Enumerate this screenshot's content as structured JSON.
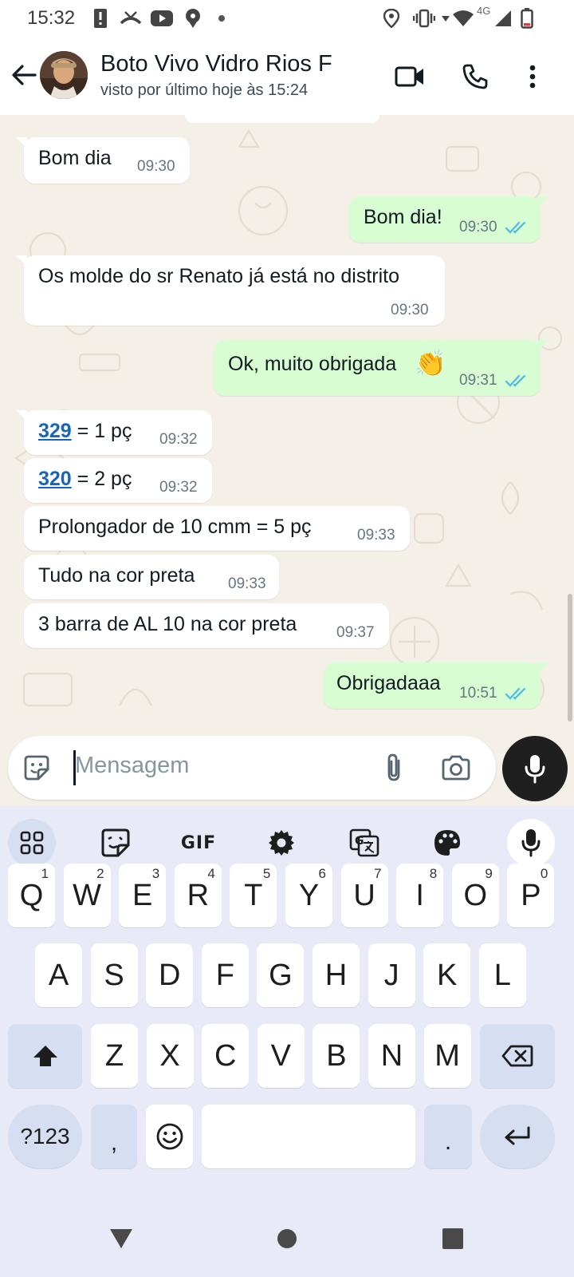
{
  "status_bar": {
    "time": "15:32",
    "network": "4G"
  },
  "header": {
    "contact_name": "Boto Vivo Vidro Rios F",
    "last_seen": "visto por último hoje às 15:24"
  },
  "messages": [
    {
      "dir": "in",
      "text": "Bom dia",
      "time": "09:30"
    },
    {
      "dir": "out",
      "text": "Bom dia!",
      "time": "09:30",
      "read": true
    },
    {
      "dir": "in",
      "text": "Os molde do sr Renato já está no distrito",
      "time": "09:30"
    },
    {
      "dir": "out",
      "text": "Ok, muito obrigada",
      "emoji": "👏",
      "time": "09:31",
      "read": true
    },
    {
      "dir": "in",
      "link": "329",
      "text": " = 1 pç",
      "time": "09:32"
    },
    {
      "dir": "in",
      "link": "320",
      "text": " = 2 pç",
      "time": "09:32"
    },
    {
      "dir": "in",
      "text": "Prolongador de 10 cmm = 5 pç",
      "time": "09:33"
    },
    {
      "dir": "in",
      "text": "Tudo na cor preta",
      "time": "09:33"
    },
    {
      "dir": "in",
      "text": "3 barra de AL 10 na cor preta",
      "time": "09:37"
    },
    {
      "dir": "out",
      "text": "Obrigadaaa",
      "time": "10:51",
      "read": true
    }
  ],
  "composer": {
    "placeholder": "Mensagem"
  },
  "keyboard": {
    "toolbar": [
      "apps-grid-icon",
      "sticker-icon",
      "GIF",
      "settings-icon",
      "translate-icon",
      "palette-icon",
      "mic-icon"
    ],
    "row1": [
      {
        "k": "Q",
        "n": "1"
      },
      {
        "k": "W",
        "n": "2"
      },
      {
        "k": "E",
        "n": "3"
      },
      {
        "k": "R",
        "n": "4"
      },
      {
        "k": "T",
        "n": "5"
      },
      {
        "k": "Y",
        "n": "6"
      },
      {
        "k": "U",
        "n": "7"
      },
      {
        "k": "I",
        "n": "8"
      },
      {
        "k": "O",
        "n": "9"
      },
      {
        "k": "P",
        "n": "0"
      }
    ],
    "row2": [
      "A",
      "S",
      "D",
      "F",
      "G",
      "H",
      "J",
      "K",
      "L"
    ],
    "row3": [
      "Z",
      "X",
      "C",
      "V",
      "B",
      "N",
      "M"
    ],
    "symbols_key": "?123",
    "comma_key": ",",
    "period_key": "."
  },
  "colors": {
    "incoming_bubble": "#ffffff",
    "outgoing_bubble": "#d9fdd3",
    "chat_background": "#f4efe7",
    "read_ticks": "#53bdeb",
    "link": "#1565c0"
  }
}
